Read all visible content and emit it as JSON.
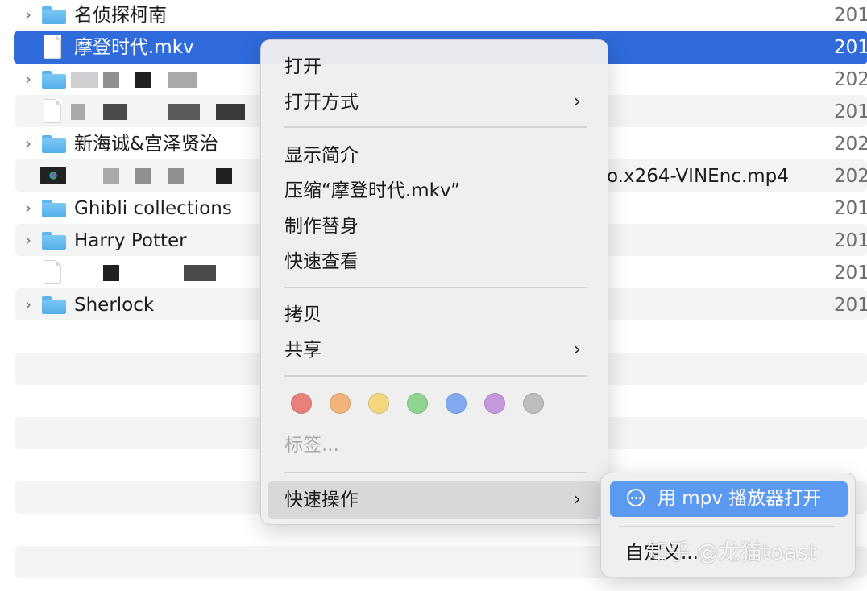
{
  "finder": {
    "rows": [
      {
        "name": "名侦探柯南",
        "date": "201",
        "kind": "folder"
      },
      {
        "name": "摩登时代.mkv",
        "date": "201",
        "kind": "file",
        "selected": true
      },
      {
        "name": "",
        "date": "202",
        "kind": "folder",
        "obscured": true
      },
      {
        "name": "",
        "date": "201",
        "kind": "file",
        "obscured": true
      },
      {
        "name": "新海诚&宫泽贤治",
        "date": "202",
        "kind": "folder"
      },
      {
        "name": "",
        "name_tail": "o.x264-VINEnc.mp4",
        "date": "202",
        "kind": "video",
        "obscured": true
      },
      {
        "name": "Ghibli collections",
        "date": "201",
        "kind": "folder"
      },
      {
        "name": "Harry Potter",
        "date": "201",
        "kind": "folder"
      },
      {
        "name": "",
        "date": "201",
        "kind": "file",
        "obscured": true
      },
      {
        "name": "Sherlock",
        "date": "201",
        "kind": "folder"
      }
    ]
  },
  "context_menu": {
    "open": "打开",
    "open_with": "打开方式",
    "get_info": "显示简介",
    "compress": "压缩“摩登时代.mkv”",
    "make_alias": "制作替身",
    "quick_look": "快速查看",
    "copy": "拷贝",
    "share": "共享",
    "tags": "标签...",
    "tag_colors": [
      "#e8807b",
      "#f2b47a",
      "#f4d77c",
      "#8fd490",
      "#82aaf0",
      "#c597de",
      "#bdbdc0"
    ],
    "quick_actions": "快速操作"
  },
  "submenu": {
    "action": "用 mpv 播放器打开",
    "customize": "自定义..."
  },
  "watermark": "知乎 @龙猫toast",
  "colors": {
    "selection": "#2f6bdb",
    "submenu_highlight": "#5b9af0"
  }
}
